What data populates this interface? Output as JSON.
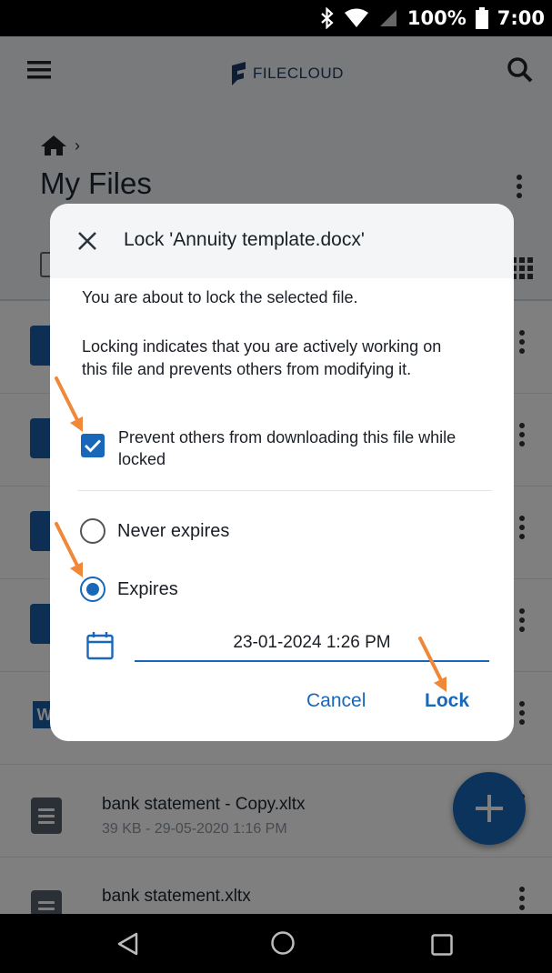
{
  "status_bar": {
    "battery_percent": "100%",
    "time": "7:00"
  },
  "app": {
    "brand": "FILECLOUD",
    "page_title": "My Files",
    "files": [
      {
        "name": "bank statement - Copy.xltx",
        "meta": "39 KB - 29-05-2020 1:16 PM"
      },
      {
        "name": "bank statement.xltx",
        "meta": ""
      }
    ]
  },
  "dialog": {
    "title": "Lock 'Annuity template.docx'",
    "intro": "You are about to lock the selected file.",
    "description": "Locking indicates that you are actively working on this file and prevents others from modifying it.",
    "prevent_download_label": "Prevent others from downloading this file while locked",
    "prevent_download_checked": true,
    "expiry_options": [
      "Never expires",
      "Expires"
    ],
    "selected_expiry": "Expires",
    "expiry_datetime": "23-01-2024 1:26 PM",
    "cancel_label": "Cancel",
    "lock_label": "Lock"
  },
  "colors": {
    "accent": "#1967b8",
    "annotation_arrow": "#f0883a"
  },
  "icons": [
    "bluetooth-icon",
    "wifi-icon",
    "signal-icon",
    "battery-icon",
    "menu-icon",
    "search-icon",
    "home-icon",
    "kebab-icon",
    "grid-view-icon",
    "close-icon",
    "calendar-icon",
    "add-icon",
    "nav-back-icon",
    "nav-home-icon",
    "nav-recents-icon"
  ]
}
